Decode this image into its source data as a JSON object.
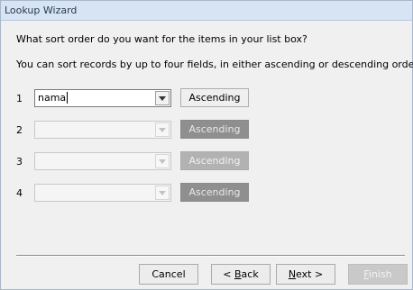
{
  "window": {
    "title": "Lookup Wizard"
  },
  "instructions": {
    "question": "What sort order do you want for the items in your list box?",
    "hint": "You can sort records by up to four fields, in either ascending or descending order."
  },
  "sort_rows": [
    {
      "number": "1",
      "field_value": "nama",
      "order_label": "Ascending",
      "enabled": true
    },
    {
      "number": "2",
      "field_value": "",
      "order_label": "Ascending",
      "enabled": false
    },
    {
      "number": "3",
      "field_value": "",
      "order_label": "Ascending",
      "enabled": false
    },
    {
      "number": "4",
      "field_value": "",
      "order_label": "Ascending",
      "enabled": false
    }
  ],
  "buttons": {
    "cancel": "Cancel",
    "back_prefix": "< ",
    "back_key": "B",
    "back_rest": "ack",
    "next_key": "N",
    "next_rest": "ext >",
    "finish_key": "F",
    "finish_rest": "inish"
  },
  "icons": {
    "dropdown": "chevron-down-icon"
  }
}
